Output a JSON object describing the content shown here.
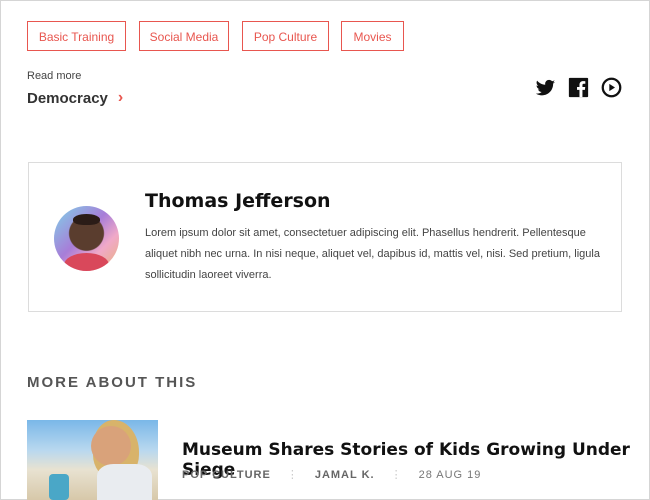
{
  "tags": [
    "Basic Training",
    "Social Media",
    "Pop Culture",
    "Movies"
  ],
  "read_more": {
    "label": "Read more",
    "link_text": "Democracy"
  },
  "social": [
    {
      "icon": "twitter-icon"
    },
    {
      "icon": "facebook-icon"
    },
    {
      "icon": "youtube-icon"
    }
  ],
  "author": {
    "name": "Thomas Jefferson",
    "bio": "Lorem ipsum dolor sit amet, consectetuer adipiscing elit. Phasellus hendrerit. Pellentesque aliquet nibh nec urna. In nisi neque, aliquet vel, dapibus id, mattis vel, nisi. Sed pretium, ligula sollicitudin laoreet viverra."
  },
  "more_about": {
    "heading": "MORE ABOUT THIS",
    "article": {
      "title": "Museum Shares Stories of Kids Growing Under Siege",
      "category": "POP CULTURE",
      "author": "JAMAL K.",
      "date": "28 AUG 19"
    }
  },
  "colors": {
    "accent": "#e8564f"
  }
}
